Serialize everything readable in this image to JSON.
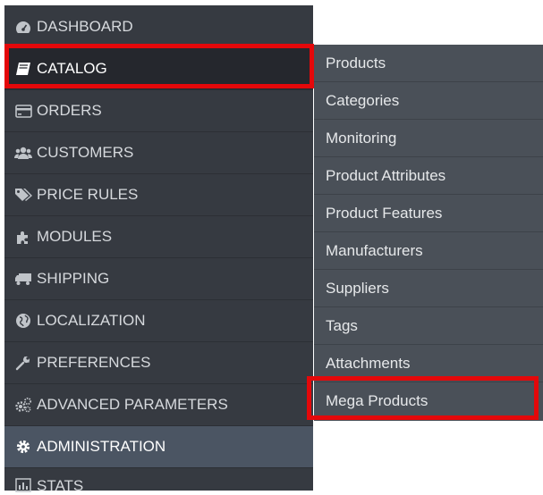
{
  "sidebar": {
    "items": [
      {
        "label": "DASHBOARD",
        "icon": "dashboard-icon"
      },
      {
        "label": "CATALOG",
        "icon": "book-icon"
      },
      {
        "label": "ORDERS",
        "icon": "credit-card-icon"
      },
      {
        "label": "CUSTOMERS",
        "icon": "users-icon"
      },
      {
        "label": "PRICE RULES",
        "icon": "tags-icon"
      },
      {
        "label": "MODULES",
        "icon": "puzzle-icon"
      },
      {
        "label": "SHIPPING",
        "icon": "truck-icon"
      },
      {
        "label": "LOCALIZATION",
        "icon": "globe-icon"
      },
      {
        "label": "PREFERENCES",
        "icon": "wrench-icon"
      },
      {
        "label": "ADVANCED PARAMETERS",
        "icon": "cogs-icon"
      },
      {
        "label": "ADMINISTRATION",
        "icon": "gear-icon"
      },
      {
        "label": "STATS",
        "icon": "bar-chart-icon"
      }
    ]
  },
  "submenu": {
    "items": [
      {
        "label": "Products"
      },
      {
        "label": "Categories"
      },
      {
        "label": "Monitoring"
      },
      {
        "label": "Product Attributes"
      },
      {
        "label": "Product Features"
      },
      {
        "label": "Manufacturers"
      },
      {
        "label": "Suppliers"
      },
      {
        "label": "Tags"
      },
      {
        "label": "Attachments"
      },
      {
        "label": "Mega Products"
      }
    ]
  },
  "colors": {
    "sidebar_bg": "#363a41",
    "active_bg": "#25272d",
    "admin_bg": "#4b5563",
    "submenu_bg": "#4a5058",
    "highlight": "#e4080a"
  }
}
